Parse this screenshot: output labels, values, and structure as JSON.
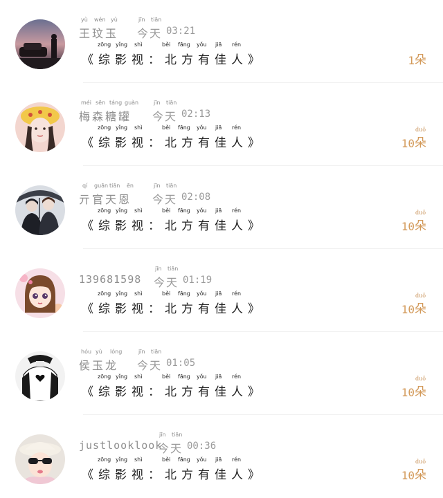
{
  "comments": [
    {
      "username": "王玟玉",
      "username_pinyin": [
        "yù",
        "wén",
        "yù"
      ],
      "time_label": "今天",
      "time_label_pinyin": [
        "jīn",
        "tiān"
      ],
      "time": "03:21",
      "message": "《综影视：北方有佳人》",
      "message_pinyin": [
        "zōng",
        "yǐng",
        "shì",
        "běi",
        "fāng",
        "yǒu",
        "jiā",
        "rén"
      ],
      "gift_count": "1",
      "gift_unit": "朵",
      "gift_unit_pinyin": ""
    },
    {
      "username": "梅森糖罐",
      "username_pinyin": [
        "méi",
        "sēn",
        "táng",
        "guàn"
      ],
      "time_label": "今天",
      "time_label_pinyin": [
        "jīn",
        "tiān"
      ],
      "time": "02:13",
      "message": "《综影视：北方有佳人》",
      "message_pinyin": [
        "zōng",
        "yǐng",
        "shì",
        "běi",
        "fāng",
        "yǒu",
        "jiā",
        "rén"
      ],
      "gift_count": "10",
      "gift_unit": "朵",
      "gift_unit_pinyin": "duǒ"
    },
    {
      "username": "亓官天恩",
      "username_pinyin": [
        "qí",
        "guān",
        "tiān",
        "ēn"
      ],
      "time_label": "今天",
      "time_label_pinyin": [
        "jīn",
        "tiān"
      ],
      "time": "02:08",
      "message": "《综影视：北方有佳人》",
      "message_pinyin": [
        "zōng",
        "yǐng",
        "shì",
        "běi",
        "fāng",
        "yǒu",
        "jiā",
        "rén"
      ],
      "gift_count": "10",
      "gift_unit": "朵",
      "gift_unit_pinyin": "duǒ"
    },
    {
      "username": "139681598",
      "username_pinyin": [],
      "time_label": "今天",
      "time_label_pinyin": [
        "jīn",
        "tiān"
      ],
      "time": "01:19",
      "message": "《综影视：北方有佳人》",
      "message_pinyin": [
        "zōng",
        "yǐng",
        "shì",
        "běi",
        "fāng",
        "yǒu",
        "jiā",
        "rén"
      ],
      "gift_count": "10",
      "gift_unit": "朵",
      "gift_unit_pinyin": "duǒ"
    },
    {
      "username": "侯玉龙",
      "username_pinyin": [
        "hóu",
        "yù",
        "lóng"
      ],
      "time_label": "今天",
      "time_label_pinyin": [
        "jīn",
        "tiān"
      ],
      "time": "01:05",
      "message": "《综影视：北方有佳人》",
      "message_pinyin": [
        "zōng",
        "yǐng",
        "shì",
        "běi",
        "fāng",
        "yǒu",
        "jiā",
        "rén"
      ],
      "gift_count": "10",
      "gift_unit": "朵",
      "gift_unit_pinyin": "duǒ"
    },
    {
      "username": "justlooklook",
      "username_pinyin": [],
      "time_label": "今天",
      "time_label_pinyin": [
        "jīn",
        "tiān"
      ],
      "time": "00:36",
      "message": "《综影视：北方有佳人》",
      "message_pinyin": [
        "zōng",
        "yǐng",
        "shì",
        "běi",
        "fāng",
        "yǒu",
        "jiā",
        "rén"
      ],
      "gift_count": "10",
      "gift_unit": "朵",
      "gift_unit_pinyin": "duǒ"
    }
  ]
}
